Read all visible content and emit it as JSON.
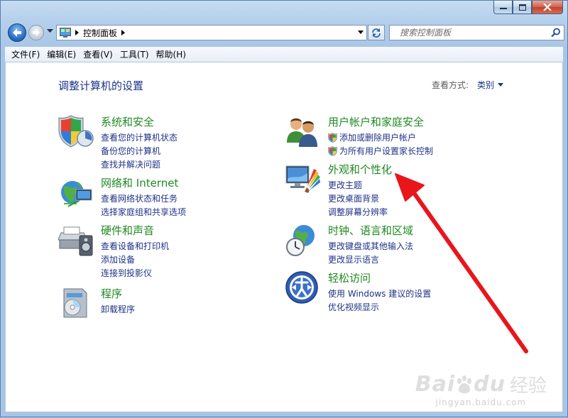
{
  "window": {
    "caption_buttons": [
      "minimize",
      "maximize",
      "close"
    ]
  },
  "navigation": {
    "breadcrumb": "控制面板",
    "search_placeholder": "搜索控制面板"
  },
  "menu": [
    "文件(F)",
    "编辑(E)",
    "查看(V)",
    "工具(T)",
    "帮助(H)"
  ],
  "content": {
    "title": "调整计算机的设置",
    "view_by_label": "查看方式:",
    "view_by_value": "类别",
    "categories": [
      {
        "title": "系统和安全",
        "icon": "system-security-icon",
        "links": [
          "查看您的计算机状态",
          "备份您的计算机",
          "查找并解决问题"
        ]
      },
      {
        "title": "网络和 Internet",
        "icon": "network-icon",
        "links": [
          "查看网络状态和任务",
          "选择家庭组和共享选项"
        ]
      },
      {
        "title": "硬件和声音",
        "icon": "hardware-sound-icon",
        "links": [
          "查看设备和打印机",
          "添加设备",
          "连接到投影仪"
        ]
      },
      {
        "title": "程序",
        "icon": "programs-icon",
        "links": [
          "卸载程序"
        ]
      },
      {
        "title": "用户帐户和家庭安全",
        "icon": "user-accounts-icon",
        "links": [
          "添加或删除用户帐户",
          "为所有用户设置家长控制"
        ],
        "shield_links": [
          0,
          1
        ]
      },
      {
        "title": "外观和个性化",
        "icon": "appearance-icon",
        "links": [
          "更改主题",
          "更改桌面背景",
          "调整屏幕分辨率"
        ]
      },
      {
        "title": "时钟、语言和区域",
        "icon": "clock-language-icon",
        "links": [
          "更改键盘或其他输入法",
          "更改显示语言"
        ]
      },
      {
        "title": "轻松访问",
        "icon": "ease-of-access-icon",
        "links": [
          "使用 Windows 建议的设置",
          "优化视频显示"
        ]
      }
    ]
  },
  "watermark": {
    "brand": "Bai",
    "brand_tail": "du",
    "word": "经验",
    "url": "jingyan.baidu.com"
  },
  "colors": {
    "category_title": "#1e8a21",
    "link": "#1e3287",
    "annotation_arrow": "#e8161b"
  }
}
